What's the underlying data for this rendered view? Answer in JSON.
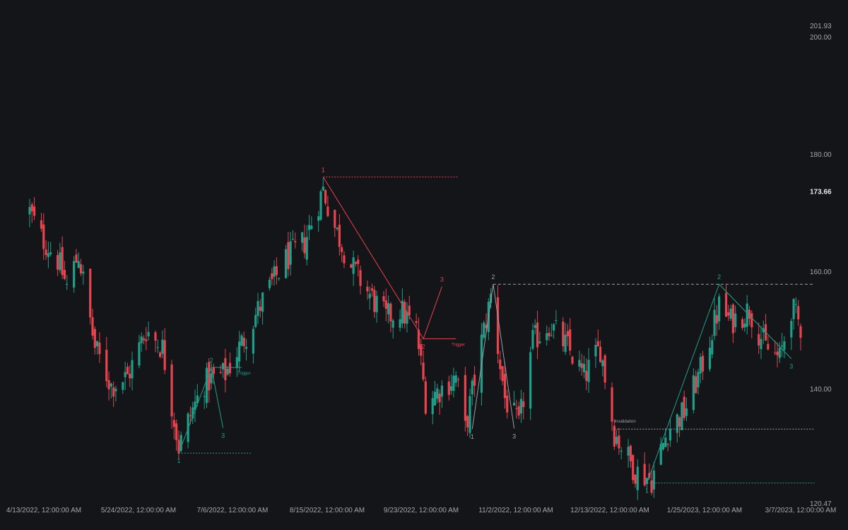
{
  "colors": {
    "background": "#141519",
    "up": "#1f9e89",
    "down": "#e8434f",
    "axis_text": "#a3a6ad",
    "neutral_label": "#9ca0a8",
    "invalidation_line": "#9ca0a8"
  },
  "chart_data": {
    "type": "candlestick",
    "title": "",
    "xlabel": "",
    "ylabel": "",
    "x_range": [
      "2022-04-11",
      "2023-03-13"
    ],
    "ylim": [
      120.47,
      201.93
    ],
    "grid": false,
    "y_ticks": [
      "201.93",
      "200.00",
      "180.00",
      "160.00",
      "140.00",
      "120.47"
    ],
    "current_price": "173.66",
    "x_ticks": [
      "4/13/2022, 12:00:00 AM",
      "5/24/2022, 12:00:00 AM",
      "7/6/2022, 12:00:00 AM",
      "8/15/2022, 12:00:00 AM",
      "9/23/2022, 12:00:00 AM",
      "11/2/2022, 12:00:00 AM",
      "12/13/2022, 12:00:00 AM",
      "1/25/2023, 12:00:00 AM",
      "3/7/2023, 12:00:00 AM"
    ],
    "close_path": [
      [
        "2022-04-13",
        170.2
      ],
      [
        "2022-04-18",
        165.8
      ],
      [
        "2022-04-25",
        162.0
      ],
      [
        "2022-04-29",
        157.4
      ],
      [
        "2022-05-04",
        163.0
      ],
      [
        "2022-05-11",
        147.0
      ],
      [
        "2022-05-18",
        140.5
      ],
      [
        "2022-05-25",
        142.0
      ],
      [
        "2022-06-02",
        150.0
      ],
      [
        "2022-06-09",
        147.0
      ],
      [
        "2022-06-16",
        130.0
      ],
      [
        "2022-06-21",
        135.5
      ],
      [
        "2022-06-27",
        141.0
      ],
      [
        "2022-07-06",
        142.5
      ],
      [
        "2022-07-14",
        148.5
      ],
      [
        "2022-07-22",
        155.0
      ],
      [
        "2022-08-01",
        162.0
      ],
      [
        "2022-08-09",
        165.0
      ],
      [
        "2022-08-17",
        174.0
      ],
      [
        "2022-08-22",
        167.5
      ],
      [
        "2022-08-29",
        161.0
      ],
      [
        "2022-09-06",
        156.0
      ],
      [
        "2022-09-13",
        152.0
      ],
      [
        "2022-09-19",
        153.5
      ],
      [
        "2022-09-26",
        150.0
      ],
      [
        "2022-09-30",
        138.2
      ],
      [
        "2022-10-07",
        140.1
      ],
      [
        "2022-10-13",
        142.0
      ],
      [
        "2022-10-17",
        133.0
      ],
      [
        "2022-10-24",
        148.0
      ],
      [
        "2022-10-28",
        155.7
      ],
      [
        "2022-11-03",
        138.4
      ],
      [
        "2022-11-09",
        133.5
      ],
      [
        "2022-11-15",
        148.0
      ],
      [
        "2022-11-22",
        151.0
      ],
      [
        "2022-11-30",
        147.0
      ],
      [
        "2022-12-07",
        142.0
      ],
      [
        "2022-12-14",
        147.0
      ],
      [
        "2022-12-20",
        132.5
      ],
      [
        "2022-12-29",
        126.0
      ],
      [
        "2023-01-05",
        124.5
      ],
      [
        "2023-01-12",
        133.0
      ],
      [
        "2023-01-19",
        136.0
      ],
      [
        "2023-01-26",
        143.0
      ],
      [
        "2023-02-03",
        154.0
      ],
      [
        "2023-02-08",
        151.5
      ],
      [
        "2023-02-16",
        153.5
      ],
      [
        "2023-02-23",
        147.0
      ],
      [
        "2023-03-01",
        145.0
      ],
      [
        "2023-03-06",
        153.8
      ],
      [
        "2023-03-10",
        150.6
      ]
    ],
    "patterns": [
      {
        "label": "bullish-1-2-3",
        "direction": "up",
        "points": [
          {
            "tag": "1",
            "date": "2022-06-16",
            "price": 129.0
          },
          {
            "tag": "2",
            "date": "2022-06-30",
            "price": 143.6
          },
          {
            "tag": "3",
            "date": "2022-07-05",
            "price": 133.3
          }
        ],
        "trigger": {
          "text": "Trigger",
          "price": 143.6,
          "from": "2022-06-30",
          "to": "2022-07-13"
        },
        "level": {
          "price": 129.0,
          "from": "2022-06-16",
          "to": "2022-07-17"
        }
      },
      {
        "label": "bearish-1-2-3",
        "direction": "down",
        "points": [
          {
            "tag": "1",
            "date": "2022-08-17",
            "price": 176.1
          },
          {
            "tag": "2",
            "date": "2022-09-29",
            "price": 148.5
          },
          {
            "tag": "3",
            "date": "2022-10-07",
            "price": 157.4
          }
        ],
        "trigger": {
          "text": "Trigger",
          "price": 148.5,
          "from": "2022-09-29",
          "to": "2022-10-13"
        },
        "level": {
          "price": 176.1,
          "from": "2022-08-17",
          "to": "2022-10-14"
        }
      },
      {
        "label": "neutral-1-2-3",
        "direction": "neutral",
        "points": [
          {
            "tag": "1",
            "date": "2022-10-20",
            "price": 133.1
          },
          {
            "tag": "2",
            "date": "2022-10-29",
            "price": 157.8
          },
          {
            "tag": "3",
            "date": "2022-11-07",
            "price": 133.2
          }
        ],
        "level": {
          "price": 157.8,
          "from": "2022-10-29",
          "to": "2023-03-16"
        },
        "invalidation": {
          "text": "Invalidation",
          "price": 133.1,
          "from": "2022-12-20",
          "to": "2023-03-16"
        }
      },
      {
        "label": "bullish-1-2-3",
        "direction": "up",
        "points": [
          {
            "tag": "1",
            "date": "2023-01-03",
            "price": 123.9
          },
          {
            "tag": "2",
            "date": "2023-02-03",
            "price": 157.8
          },
          {
            "tag": "3",
            "date": "2023-03-06",
            "price": 145.1
          }
        ],
        "level": {
          "price": 123.9,
          "from": "2023-01-03",
          "to": "2023-03-16"
        }
      }
    ]
  }
}
